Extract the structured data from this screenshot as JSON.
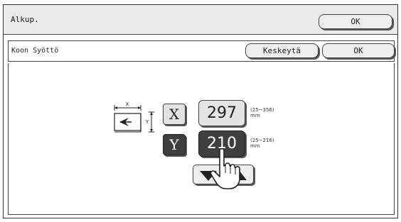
{
  "header": {
    "title": "Alkup.",
    "ok_label": "OK"
  },
  "subheader": {
    "title": "Koon Syöttö",
    "cancel_label": "Keskeytä",
    "ok_label": "OK"
  },
  "paper_size": {
    "x": {
      "axis_label": "X",
      "value": "297",
      "range": "(25~356)",
      "unit": "mm",
      "selected": false
    },
    "y": {
      "axis_label": "Y",
      "value": "210",
      "range": "(25~216)",
      "unit": "mm",
      "selected": true
    },
    "diagram": {
      "x_label": "X",
      "y_label": "Y"
    }
  },
  "icons": {
    "paper_orientation": "paper-size-diagram-icon",
    "stepper_down": "triangle-down-icon",
    "stepper_up": "triangle-up-icon",
    "pointer": "pointing-hand-icon"
  },
  "colors": {
    "selected_bg": "#3f3f3f",
    "button_bg": "#e4e4e4",
    "border": "#444444"
  }
}
